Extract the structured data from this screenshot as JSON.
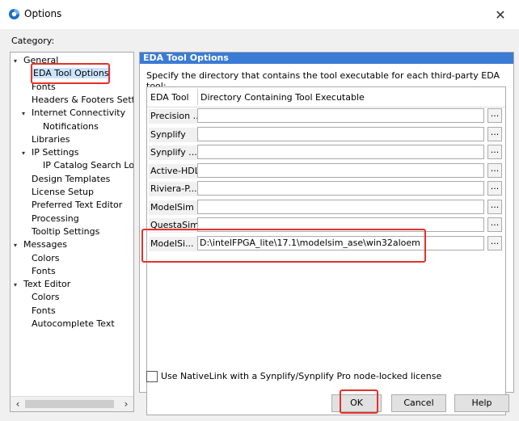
{
  "window": {
    "title": "Options"
  },
  "category_label": "Category:",
  "tree": [
    {
      "label": "General",
      "level": 0,
      "expanded": true
    },
    {
      "label": "EDA Tool Options",
      "level": 1,
      "selected": true
    },
    {
      "label": "Fonts",
      "level": 1
    },
    {
      "label": "Headers & Footers Settir",
      "level": 1
    },
    {
      "label": "Internet Connectivity",
      "level": 1,
      "expanded": true
    },
    {
      "label": "Notifications",
      "level": 2
    },
    {
      "label": "Libraries",
      "level": 1
    },
    {
      "label": "IP Settings",
      "level": 1,
      "expanded": true
    },
    {
      "label": "IP Catalog Search Loc",
      "level": 2
    },
    {
      "label": "Design Templates",
      "level": 1
    },
    {
      "label": "License Setup",
      "level": 1
    },
    {
      "label": "Preferred Text Editor",
      "level": 1
    },
    {
      "label": "Processing",
      "level": 1
    },
    {
      "label": "Tooltip Settings",
      "level": 1
    },
    {
      "label": "Messages",
      "level": 0,
      "expanded": true
    },
    {
      "label": "Colors",
      "level": 1
    },
    {
      "label": "Fonts",
      "level": 1
    },
    {
      "label": "Text Editor",
      "level": 0,
      "expanded": true
    },
    {
      "label": "Colors",
      "level": 1
    },
    {
      "label": "Fonts",
      "level": 1
    },
    {
      "label": "Autocomplete Text",
      "level": 1
    }
  ],
  "panel": {
    "title": "EDA Tool Options",
    "description": "Specify the directory that contains the tool executable for each third-party EDA tool:",
    "columns": [
      "EDA Tool",
      "Directory Containing Tool Executable"
    ],
    "rows": [
      {
        "tool": "Precision ...",
        "path": ""
      },
      {
        "tool": "Synplify",
        "path": ""
      },
      {
        "tool": "Synplify ...",
        "path": ""
      },
      {
        "tool": "Active-HDL",
        "path": ""
      },
      {
        "tool": "Riviera-P...",
        "path": ""
      },
      {
        "tool": "ModelSim",
        "path": ""
      },
      {
        "tool": "QuestaSim",
        "path": ""
      },
      {
        "tool": "ModelSi...",
        "path": "D:\\intelFPGA_lite\\17.1\\modelsim_ase\\win32aloem"
      }
    ],
    "browse_label": "...",
    "nativelink_label": "Use NativeLink with a Synplify/Synplify Pro node-locked license",
    "nativelink_checked": false
  },
  "buttons": {
    "ok": "OK",
    "cancel": "Cancel",
    "help": "Help"
  },
  "colors": {
    "header_bg": "#3a7bd5",
    "highlight": "#e4312b",
    "selected_bg": "#cce4ff"
  }
}
